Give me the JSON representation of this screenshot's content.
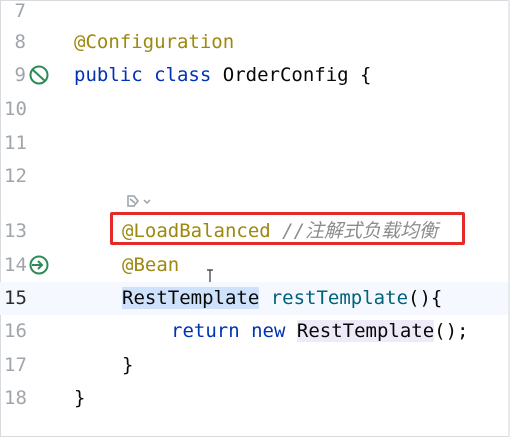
{
  "editor": {
    "lines": [
      {
        "num": "7"
      },
      {
        "num": "8",
        "annotation": "@Configuration"
      },
      {
        "num": "9",
        "kw1": "public",
        "kw2": "class",
        "name": "OrderConfig",
        "brace": "{"
      },
      {
        "num": "10"
      },
      {
        "num": "11"
      },
      {
        "num": "12"
      },
      {
        "num": "13",
        "annotation": "@LoadBalanced",
        "comment": "//注解式负载均衡"
      },
      {
        "num": "14",
        "annotation": "@Bean"
      },
      {
        "num": "15",
        "type": "RestTemplate",
        "method": "restTemplate",
        "rest": "(){"
      },
      {
        "num": "16",
        "kw1": "return",
        "kw2": "new",
        "type": "RestTemplate",
        "rest": "();"
      },
      {
        "num": "17",
        "brace": "}"
      },
      {
        "num": "18",
        "brace": "}"
      }
    ],
    "current_line": "15"
  },
  "colors": {
    "keyword": "#0033b3",
    "annotation": "#9e880d",
    "comment": "#8c8c8c",
    "method": "#00627a",
    "highlight_box": "#e52a2a",
    "bean_icon": "#2e8b57"
  },
  "icons": {
    "line9": "spring-bean-config-icon",
    "line14": "spring-bean-icon",
    "hint": "intention-bulb-icon"
  }
}
